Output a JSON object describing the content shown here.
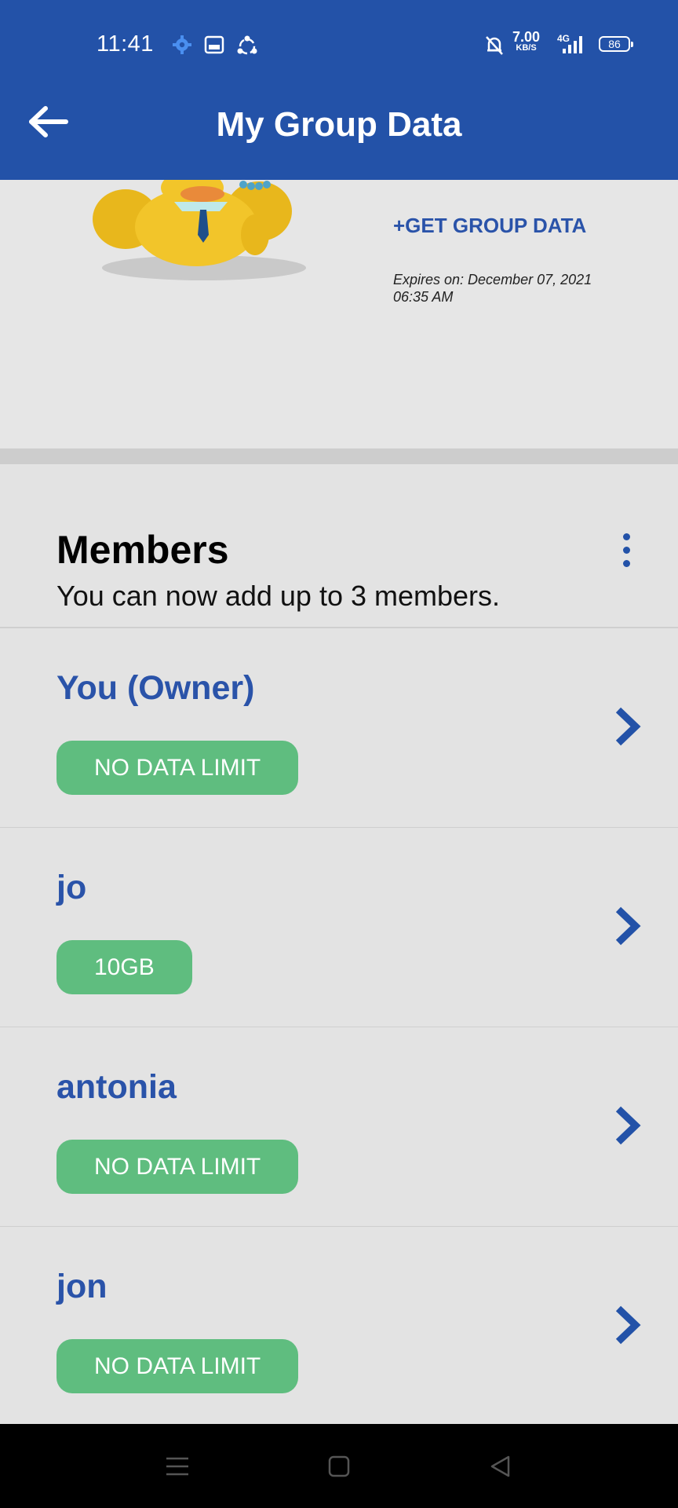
{
  "status_bar": {
    "time": "11:41",
    "net_speed_value": "7.00",
    "net_speed_unit": "KB/S",
    "network_type": "4G",
    "battery": "86",
    "icons": [
      "gear-icon",
      "gallery-icon",
      "sync-icon",
      "bell-off-icon",
      "signal-icon",
      "battery-icon"
    ]
  },
  "app_bar": {
    "title": "My Group Data",
    "back_icon": "arrow-left-icon"
  },
  "hero": {
    "get_data_label": "+GET GROUP DATA",
    "expires_text": "Expires on: December 07, 2021 06:35 AM"
  },
  "members": {
    "title": "Members",
    "subtitle": "You can now add up to 3 members.",
    "list": [
      {
        "name": "You (Owner)",
        "limit": "NO DATA LIMIT"
      },
      {
        "name": "jo",
        "limit": "10GB"
      },
      {
        "name": "antonia",
        "limit": "NO DATA LIMIT"
      },
      {
        "name": "jon",
        "limit": "NO DATA LIMIT"
      }
    ]
  },
  "colors": {
    "brand_blue": "#2352a8",
    "link_blue": "#2a53a9",
    "pill_green": "#5fbd7f",
    "background": "#e3e3e3"
  }
}
